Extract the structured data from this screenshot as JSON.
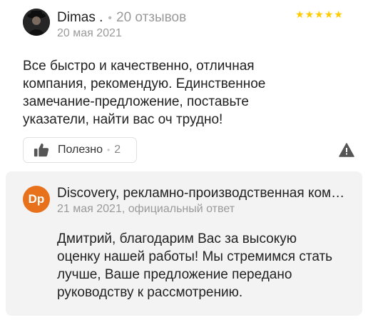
{
  "review": {
    "author_name": "Dimas .",
    "separator": "•",
    "reviews_count": "20 отзывов",
    "date": "20 мая 2021",
    "rating": 5,
    "rating_max": 5,
    "star_color": "#ffcc00",
    "text": "Все быстро и качественно, отличная компания, рекомендую. Единственное замечание-предложение, поставьте указатели, найти вас оч трудно!",
    "useful_label": "Полезно",
    "useful_count": "2",
    "report_icon": "warning-triangle-icon"
  },
  "reply": {
    "avatar_initials": "Dp",
    "avatar_color": "#e8721c",
    "org_name": "Discovery, рекламно-производственная компания",
    "meta": "21 мая 2021, официальный ответ",
    "text": "Дмитрий, благодарим Вас за высокую оценку нашей работы! Мы стремимся стать лучше, Ваше предложение передано руководству к рассмотрению."
  }
}
